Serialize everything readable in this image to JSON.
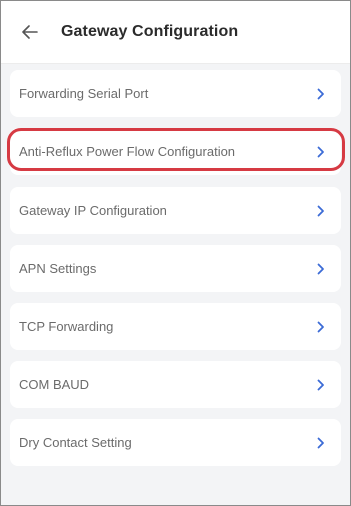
{
  "header": {
    "title": "Gateway Configuration",
    "back_icon": "arrow-left-icon"
  },
  "menu": {
    "items": [
      {
        "label": "Forwarding Serial Port"
      },
      {
        "label": "Anti-Reflux Power Flow Configuration",
        "highlighted": true
      },
      {
        "label": "Gateway IP Configuration"
      },
      {
        "label": "APN Settings"
      },
      {
        "label": "TCP Forwarding"
      },
      {
        "label": "COM BAUD"
      },
      {
        "label": "Dry Contact Setting"
      }
    ],
    "chevron_icon": "chevron-right-icon"
  },
  "colors": {
    "background": "#f3f4f6",
    "card": "#ffffff",
    "chevron": "#3b6bd6",
    "highlight": "#d63a43"
  }
}
